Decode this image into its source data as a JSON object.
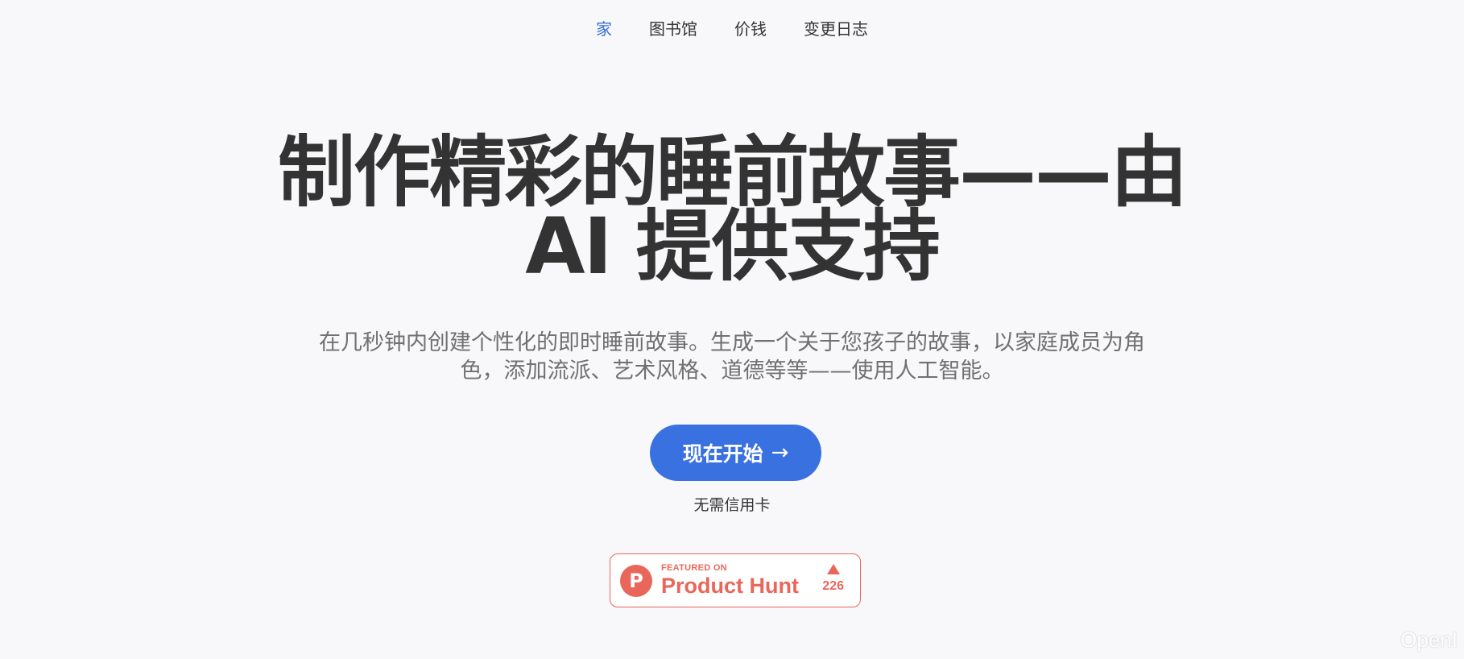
{
  "nav": {
    "items": [
      {
        "label": "家",
        "active": true
      },
      {
        "label": "图书馆",
        "active": false
      },
      {
        "label": "价钱",
        "active": false
      },
      {
        "label": "变更日志",
        "active": false
      }
    ]
  },
  "hero": {
    "title_line1": "制作精彩的睡前故事——由",
    "title_line2": "AI 提供支持",
    "subtitle": "在几秒钟内创建个性化的即时睡前故事。生成一个关于您孩子的故事，以家庭成员为角色，添加流派、艺术风格、道德等等——使用人工智能。",
    "cta_label": "现在开始",
    "cta_arrow": "→",
    "no_card": "无需信用卡"
  },
  "product_hunt": {
    "logo_letter": "P",
    "featured": "FEATURED ON",
    "name": "Product Hunt",
    "votes": "226"
  },
  "watermark": "OpenI",
  "colors": {
    "accent": "#3a71e0",
    "nav_active": "#3a6fd8",
    "product_hunt": "#e8675a",
    "background": "#f8f8fa",
    "text": "#333333"
  }
}
